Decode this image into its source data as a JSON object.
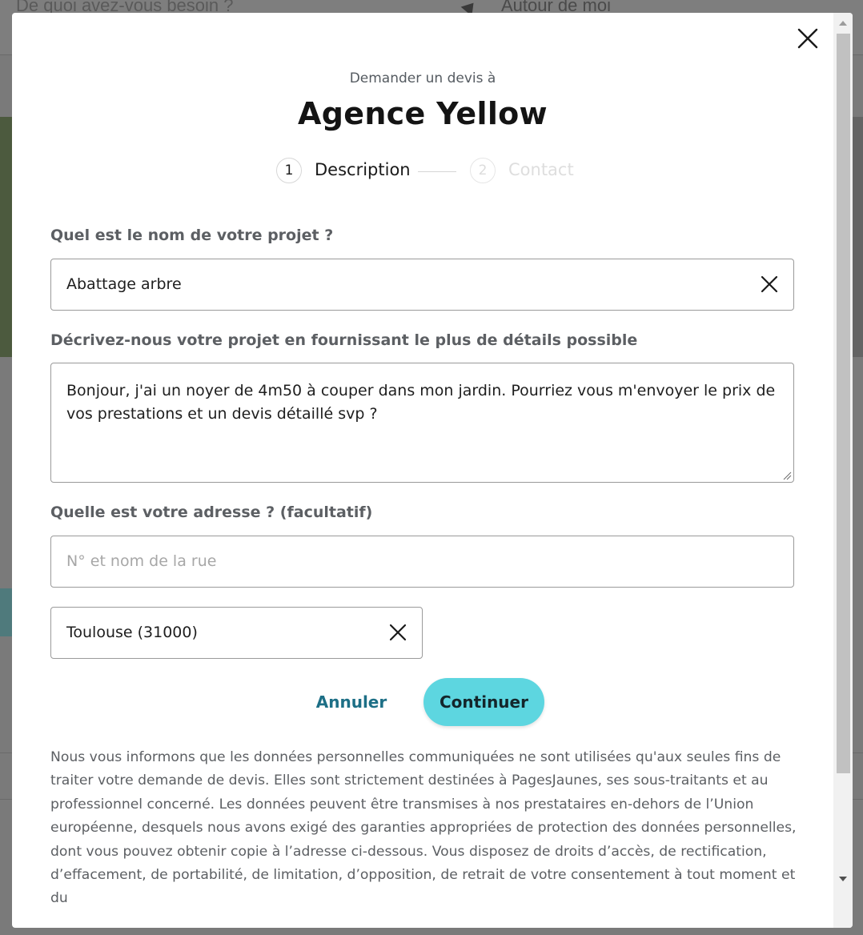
{
  "background": {
    "search_placeholder": "De quoi avez-vous besoin ?",
    "location_label": "Autour de moi"
  },
  "modal": {
    "subtitle": "Demander un devis à",
    "title": "Agence Yellow",
    "close_icon": "close-icon",
    "steps": [
      {
        "number": "1",
        "label": "Description",
        "active": true
      },
      {
        "number": "2",
        "label": "Contact",
        "active": false
      }
    ],
    "project_name": {
      "label": "Quel est le nom de votre projet ?",
      "value": "Abattage arbre"
    },
    "description": {
      "label": "Décrivez-nous votre projet en fournissant le plus de détails possible",
      "value": "Bonjour, j'ai un noyer de 4m50 à couper dans mon jardin. Pourriez vous m'envoyer le prix de vos prestations et un devis détaillé svp ?"
    },
    "address": {
      "label": "Quelle est votre adresse ? (facultatif)",
      "street_placeholder": "N° et nom de la rue",
      "street_value": "",
      "city_value": "Toulouse (31000)"
    },
    "buttons": {
      "cancel": "Annuler",
      "continue": "Continuer"
    },
    "legal_text": "Nous vous informons que les données personnelles communiquées ne sont utilisées qu'aux seules fins de traiter votre demande de devis. Elles sont strictement destinées à PagesJaunes, ses sous-traitants et au professionnel concerné. Les données peuvent être transmises à nos prestataires en-dehors de l’Union européenne, desquels nous avons exigé des garanties appropriées de protection des données personnelles, dont vous pouvez obtenir copie à l’adresse ci-dessous. Vous disposez de droits d’accès, de rectification, d’effacement, de portabilité, de limitation, d’opposition, de retrait de votre consentement à tout moment et du"
  },
  "colors": {
    "accent": "#5dd6e0",
    "link": "#1d6f86",
    "overlay": "#7a7a7a"
  }
}
